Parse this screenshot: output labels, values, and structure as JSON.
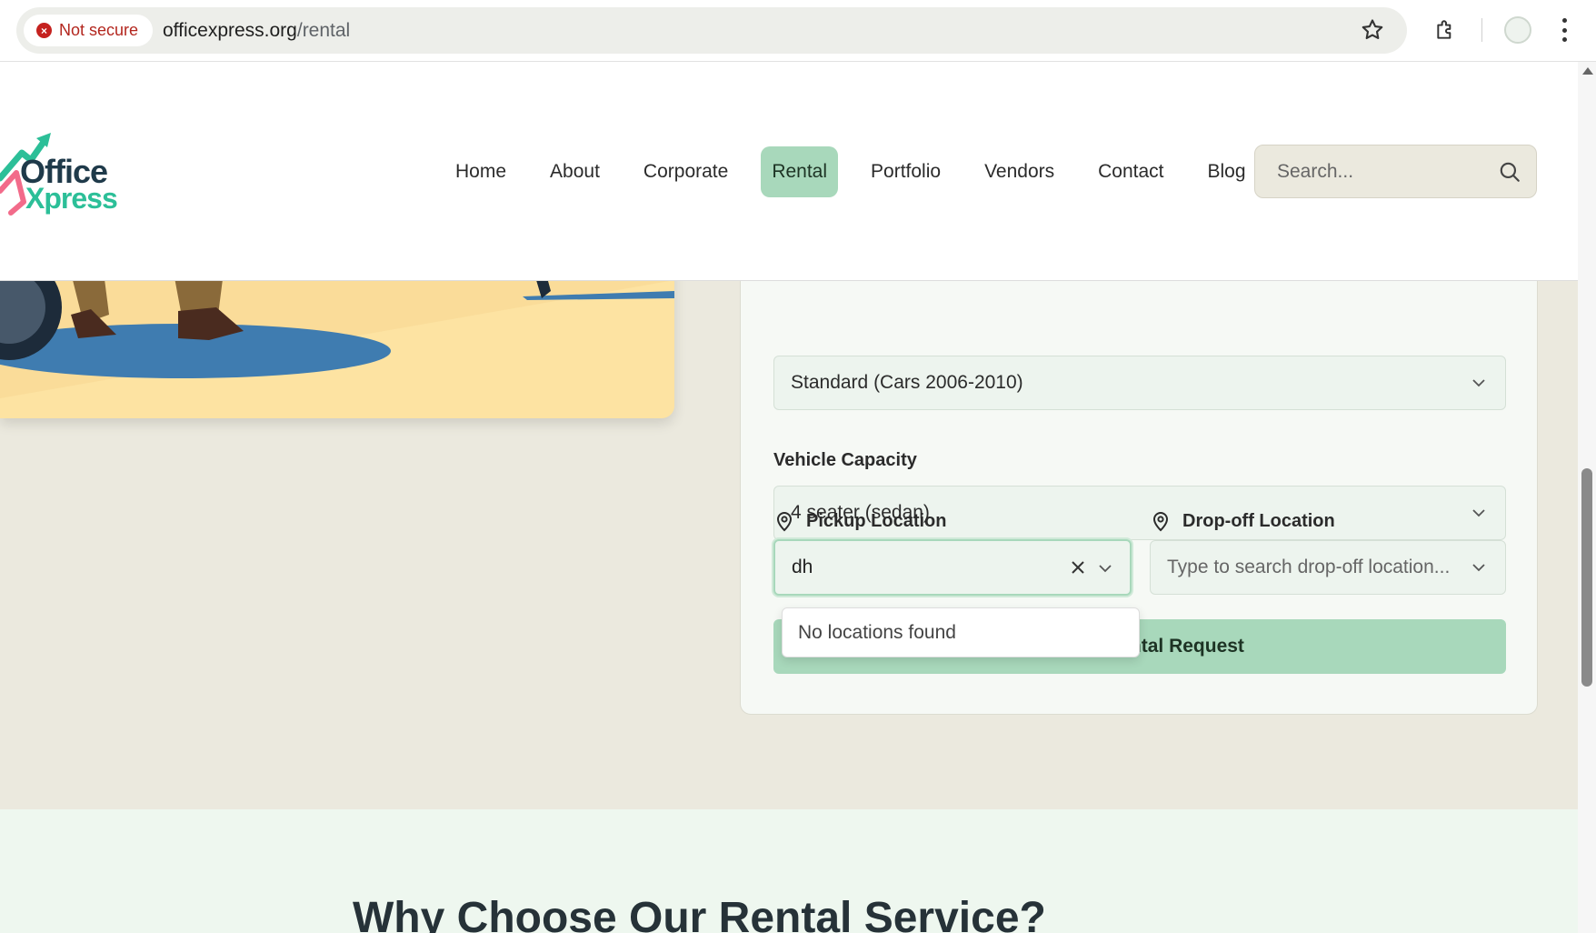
{
  "browser": {
    "security_label": "Not secure",
    "url_domain": "officexpress.org",
    "url_path": "/rental"
  },
  "logo": {
    "line1": "Office",
    "line2": "Xpress"
  },
  "nav": {
    "items": [
      "Home",
      "About",
      "Corporate",
      "Rental",
      "Portfolio",
      "Vendors",
      "Contact",
      "Blog"
    ],
    "active": "Rental"
  },
  "site_search": {
    "placeholder": "Search..."
  },
  "form": {
    "vehicle_type_value": "Standard (Cars 2006-2010)",
    "capacity_label": "Vehicle Capacity",
    "capacity_value": "4 seater (sedan)",
    "pickup_label": "Pickup Location",
    "pickup_value": "dh",
    "dropoff_label": "Drop-off Location",
    "dropoff_placeholder": "Type to search drop-off location...",
    "submit_label": "Submit Rental Request",
    "no_results": "No locations found"
  },
  "section": {
    "heading": "Why Choose Our Rental Service?"
  },
  "colors": {
    "accent": "#a8d8bb",
    "page_bg": "#ebe9de",
    "brand_dark": "#1f3a4a",
    "brand_teal": "#2cbf98"
  }
}
